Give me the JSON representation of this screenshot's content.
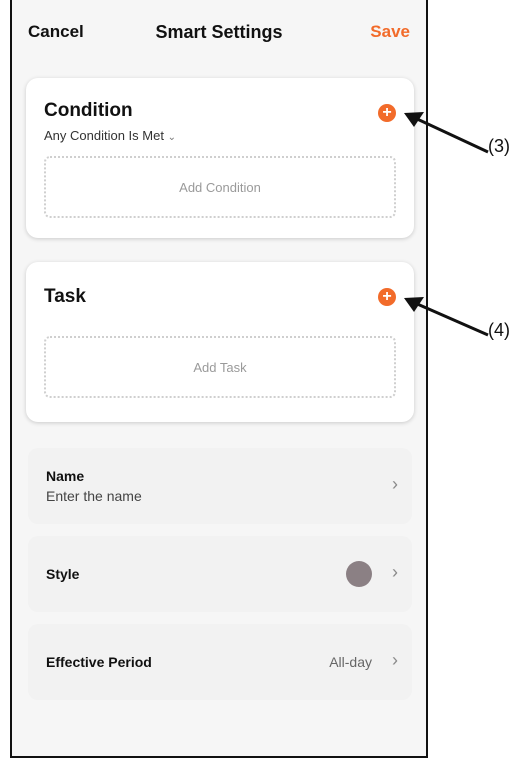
{
  "header": {
    "cancel": "Cancel",
    "title": "Smart Settings",
    "save": "Save"
  },
  "condition": {
    "title": "Condition",
    "match_mode": "Any Condition Is Met",
    "add_label": "Add Condition"
  },
  "task": {
    "title": "Task",
    "add_label": "Add Task"
  },
  "name_row": {
    "label": "Name",
    "placeholder": "Enter the name"
  },
  "style_row": {
    "label": "Style",
    "swatch_color": "#8b8084"
  },
  "period_row": {
    "label": "Effective Period",
    "value": "All-day"
  },
  "callouts": {
    "condition_add": "(3)",
    "task_add": "(4)"
  },
  "colors": {
    "accent": "#f26b2a"
  }
}
